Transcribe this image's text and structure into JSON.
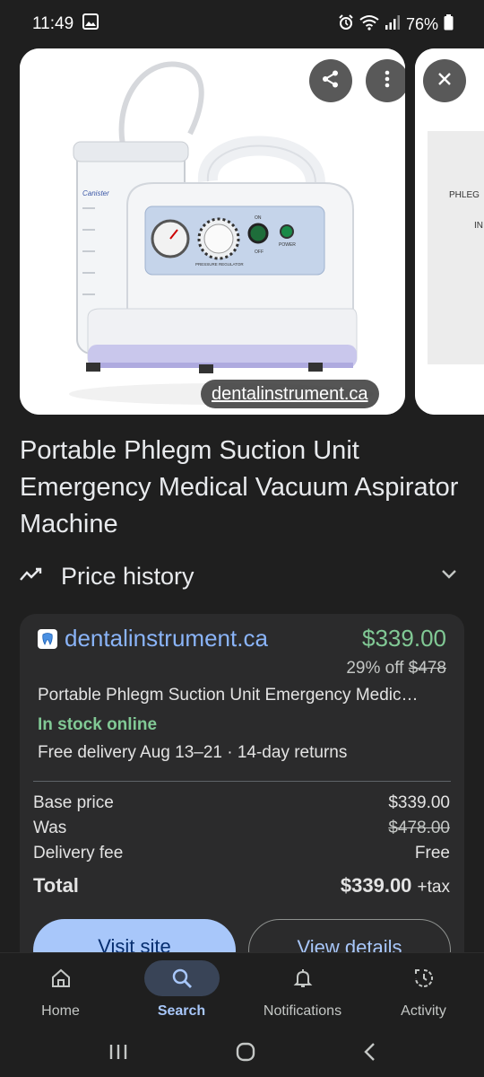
{
  "status_bar": {
    "time": "11:49",
    "battery": "76%",
    "icons": [
      "gallery-icon",
      "alarm-icon",
      "wifi-icon",
      "signal-icon",
      "battery-icon"
    ]
  },
  "hero": {
    "source_label": "dentalinstrument.ca",
    "product_image_label": "Portable phlegm suction unit",
    "canister_label": "Canister",
    "gauge_labels": [
      "ON",
      "OFF",
      "POWER",
      "PRESSURE REGULATOR"
    ],
    "side_image_text": [
      "PHLEG",
      "IN"
    ],
    "buttons": [
      "share-icon",
      "more-vert-icon",
      "close-icon"
    ]
  },
  "product": {
    "title": "Portable Phlegm Suction Unit Emergency Medical Vacuum Aspirator Machine"
  },
  "price_history": {
    "label": "Price history"
  },
  "offer": {
    "store": "dentalinstrument.ca",
    "price": "$339.00",
    "discount": "29% off",
    "original_price": "$478",
    "product_name": "Portable Phlegm Suction Unit Emergency Medic…",
    "stock": "In stock online",
    "delivery": "Free delivery Aug 13–21 · 14-day returns",
    "breakdown": {
      "base_label": "Base price",
      "base_value": "$339.00",
      "was_label": "Was",
      "was_value": "$478.00",
      "delivery_label": "Delivery fee",
      "delivery_value": "Free",
      "total_label": "Total",
      "total_value": "$339.00",
      "total_suffix": "+tax"
    },
    "visit_button": "Visit site",
    "details_button": "View details"
  },
  "bottom_nav": {
    "items": [
      {
        "label": "Home",
        "icon": "home-icon"
      },
      {
        "label": "Search",
        "icon": "search-icon",
        "active": true
      },
      {
        "label": "Notifications",
        "icon": "bell-icon"
      },
      {
        "label": "Activity",
        "icon": "activity-icon"
      }
    ]
  },
  "colors": {
    "background": "#1f1f1f",
    "link": "#8ab4f8",
    "price_green": "#81c995",
    "primary_button": "#a8c7fa"
  }
}
